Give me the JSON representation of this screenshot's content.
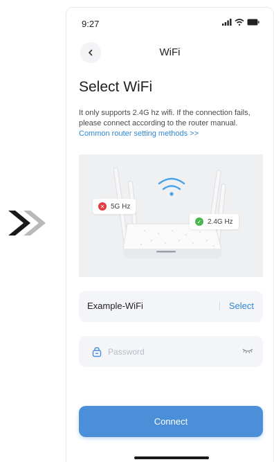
{
  "status_bar": {
    "time": "9:27",
    "icons": [
      "signal-icon",
      "wifi-icon",
      "battery-icon"
    ]
  },
  "header": {
    "back_icon": "chevron-left-icon",
    "title": "WiFi"
  },
  "main": {
    "title": "Select WiFi",
    "description": "It only supports 2.4G hz wifi. If the connection fails, please connect according to the router manual.",
    "help_link": "Common router setting methods >>"
  },
  "illustration": {
    "badge_5g": {
      "label": "5G Hz",
      "status": "unsupported"
    },
    "badge_24g": {
      "label": "2.4G Hz",
      "status": "supported"
    }
  },
  "form": {
    "network_name": "Example-WiFi",
    "select_label": "Select",
    "password_placeholder": "Password",
    "password_value": ""
  },
  "actions": {
    "connect_label": "Connect"
  },
  "colors": {
    "accent": "#4a8fd8",
    "link": "#2f86d6",
    "error": "#e23c40",
    "success": "#49b64e"
  }
}
